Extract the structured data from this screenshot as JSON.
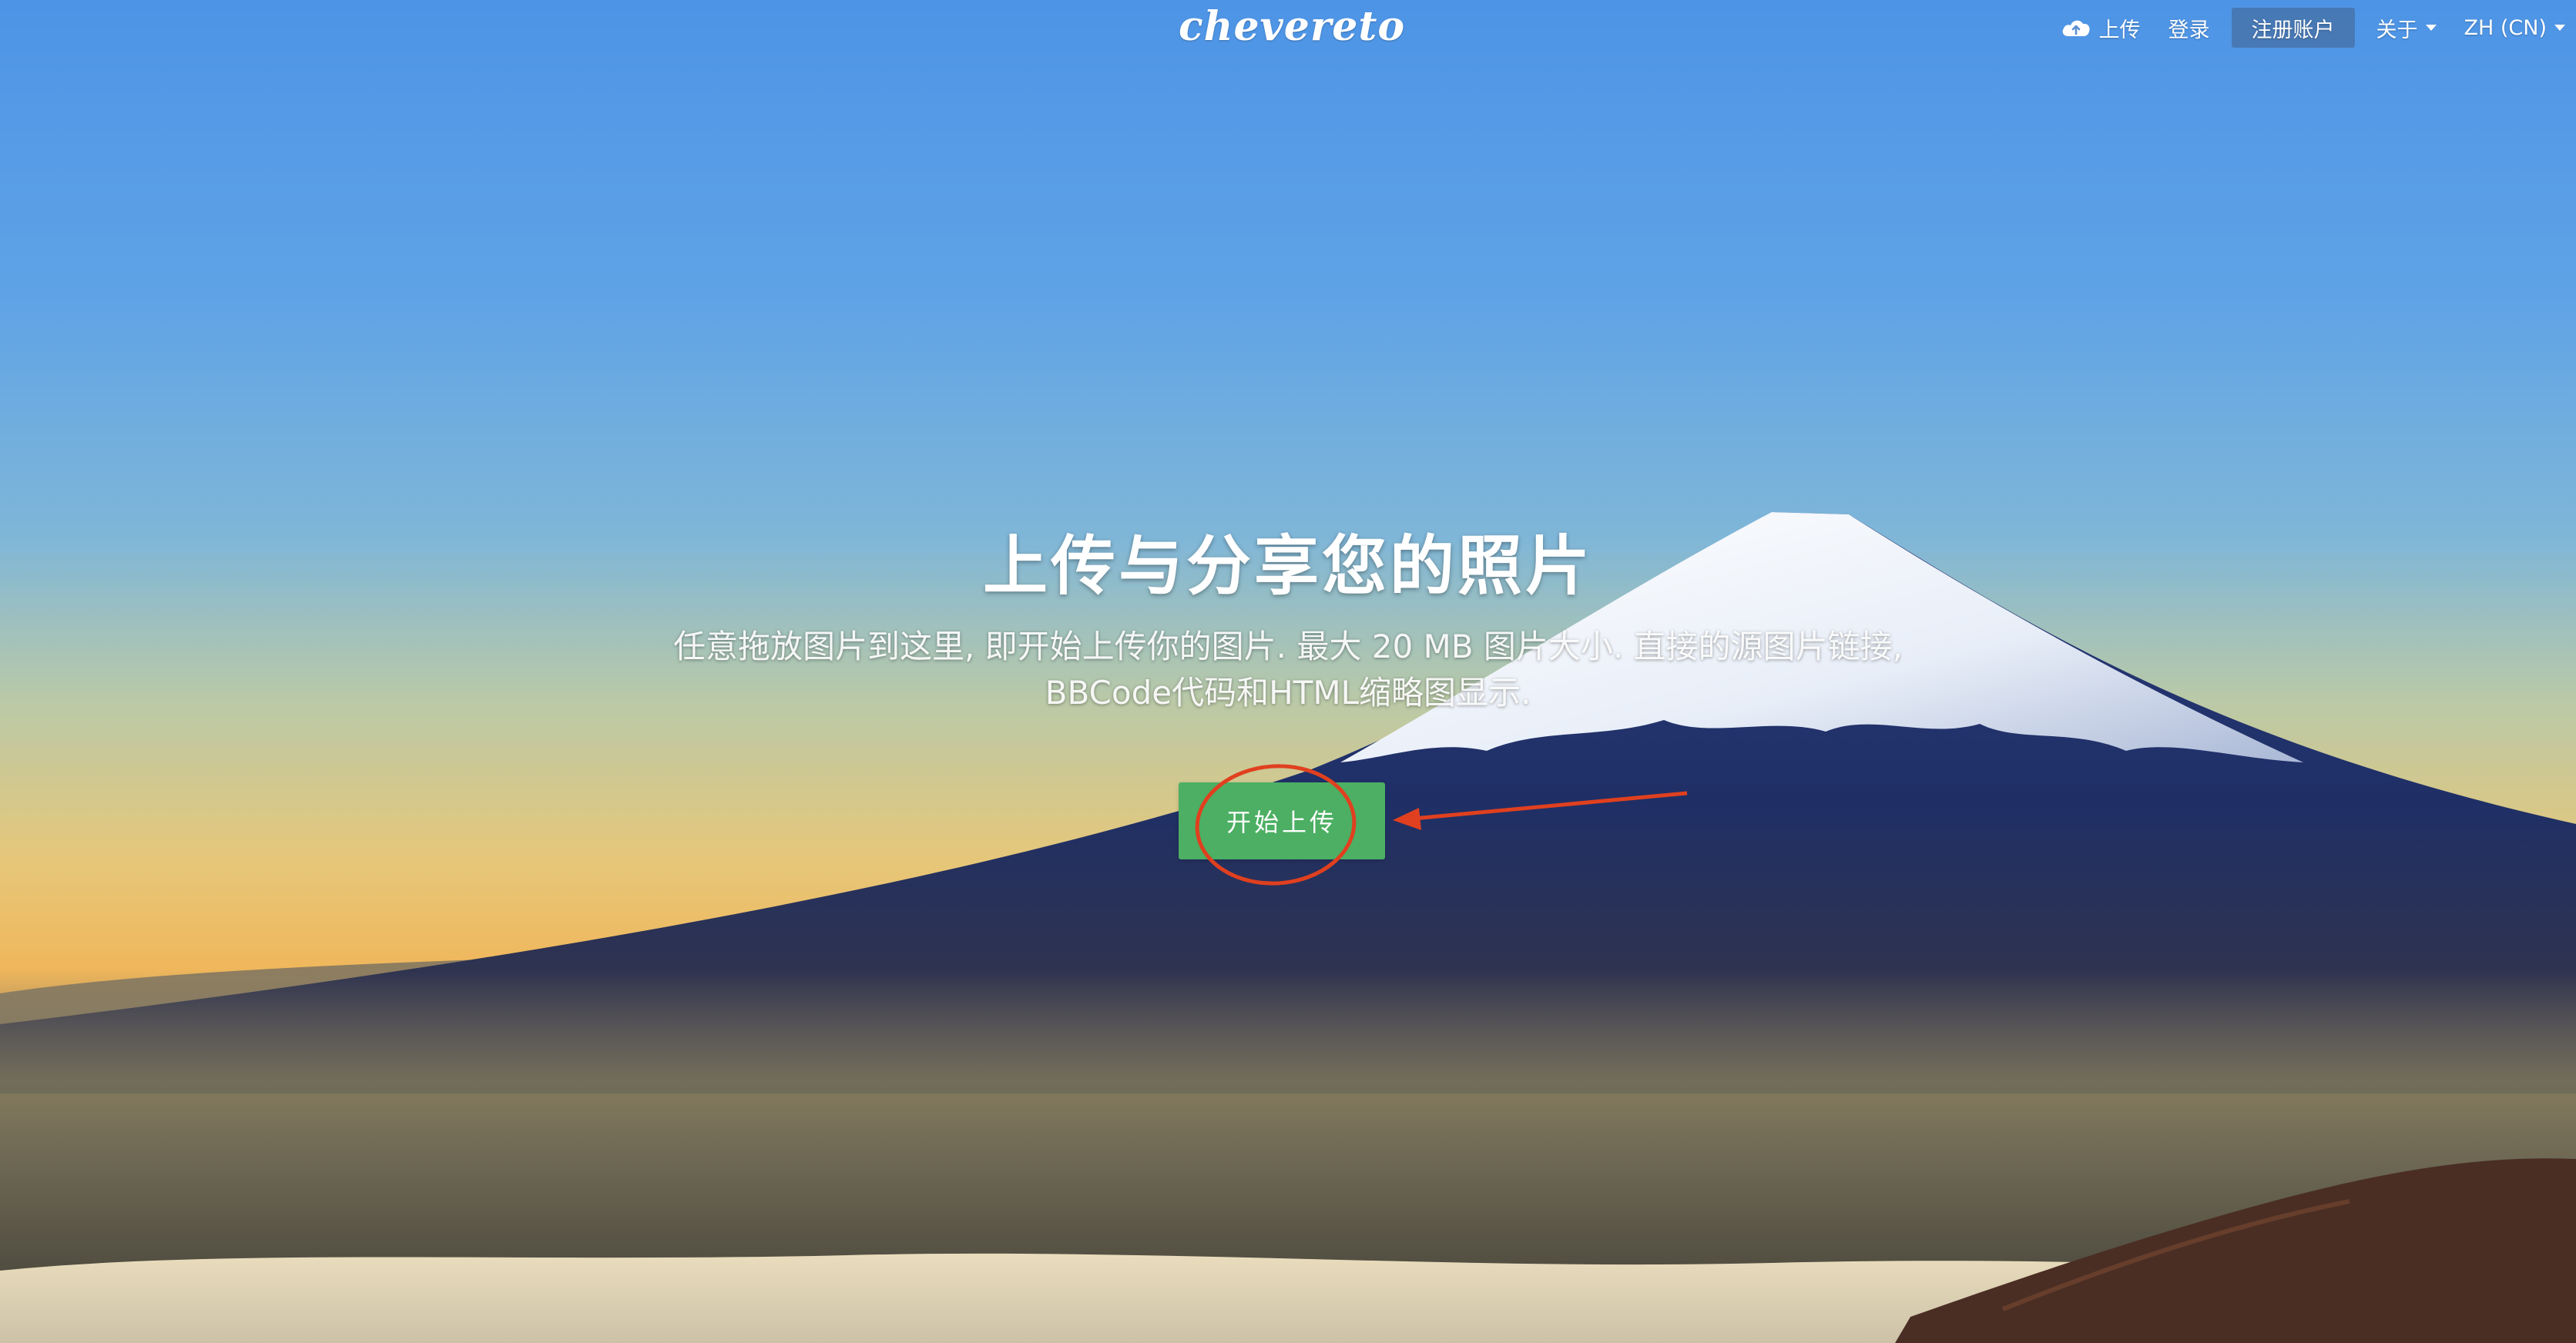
{
  "header": {
    "logo_text": "chevereto",
    "nav": {
      "upload_label": "上传",
      "upload_icon": "cloud-upload-icon",
      "login_label": "登录",
      "register_label": "注册账户",
      "about_label": "关于",
      "language_label": "ZH (CN)"
    }
  },
  "hero": {
    "title": "上传与分享您的照片",
    "description": "任意拖放图片到这里, 即开始上传你的图片. 最大 20 MB 图片大小. 直接的源图片链接, BBCode代码和HTML缩略图显示.",
    "start_button_label": "开始上传"
  },
  "annotation": {
    "color": "#e0401f"
  },
  "colors": {
    "button_green": "#4caf63",
    "sky_blue": "#4d94e6",
    "horizon_orange": "#f0b75c"
  }
}
